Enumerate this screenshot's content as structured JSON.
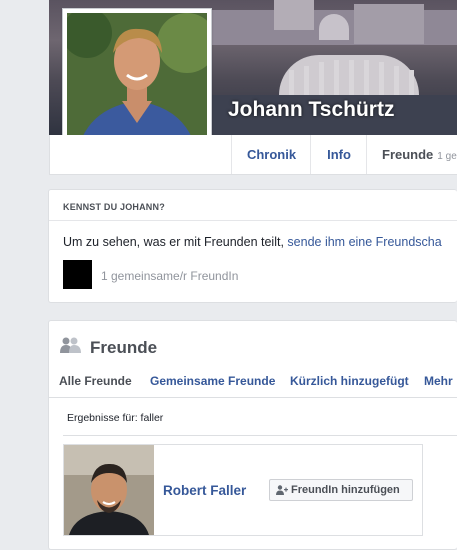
{
  "profile": {
    "name": "Johann Tschürtz"
  },
  "tabs": {
    "chronik": "Chronik",
    "info": "Info",
    "freunde": "Freunde",
    "freunde_count": "1 ge"
  },
  "know_card": {
    "heading": "KENNST DU JOHANN?",
    "text_prefix": "Um zu sehen, was er mit Freunden teilt,",
    "text_link": "sende ihm eine Freundscha",
    "mutual": "1 gemeinsame/r FreundIn"
  },
  "friends_section": {
    "title": "Freunde",
    "tabs": [
      "Alle Freunde",
      "Gemeinsame Freunde",
      "Kürzlich hinzugefügt",
      "Mehr"
    ],
    "results_label": "Ergebnisse für: faller",
    "result": {
      "name": "Robert Faller",
      "add_button": "FreundIn hinzufügen"
    }
  },
  "colors": {
    "link": "#365899",
    "background": "#e9ebee",
    "muted_text": "#90949c"
  }
}
